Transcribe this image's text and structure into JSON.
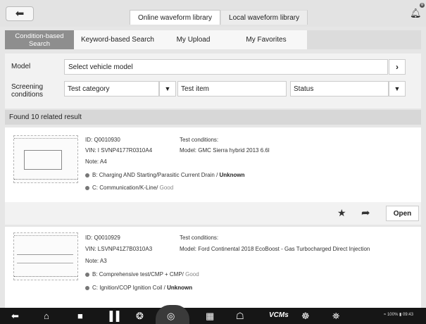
{
  "header": {
    "tabs": [
      {
        "label": "Online waveform library",
        "active": true
      },
      {
        "label": "Local waveform library",
        "active": false
      }
    ]
  },
  "subtabs": [
    {
      "label": "Condition-based Search",
      "active": true
    },
    {
      "label": "Keyword-based Search",
      "active": false
    },
    {
      "label": "My Upload",
      "active": false
    },
    {
      "label": "My Favorites",
      "active": false
    }
  ],
  "filters": {
    "model_label": "Model",
    "model_value": "Select vehicle model",
    "screening_label": "Screening conditions",
    "test_category": "Test category",
    "test_item": "Test item",
    "status": "Status"
  },
  "found_text": "Found 10 related result",
  "results": [
    {
      "id": "ID: Q0010930",
      "vin": "VIN: I SVNP4177R0310A4",
      "note": "Note: A4",
      "test_conditions_label": "Test conditions:",
      "model": "Model: GMC Sierra hybrid 2013 6.6l",
      "line_b_text": "B: Charging AND Starting/Parasitic Current Drain / ",
      "line_b_status": "Unknown",
      "line_c_text": "C: Communication/K-Line/ ",
      "line_c_status": "Good",
      "open_label": "Open"
    },
    {
      "id": "ID: Q0010929",
      "vin": "VIN: LSVNP41Z7B0310A3",
      "note": "Note: A3",
      "test_conditions_label": "Test conditions:",
      "model": "Model: Ford Continental 2018 EcoBoost - Gas Turbocharged Direct Injection",
      "line_b_text": "B: Comprehensive test/CMP + CMP/ ",
      "line_b_status": "Good",
      "line_c_text": "C: Ignition/COP Ignition Coil / ",
      "line_c_status": "Unknown"
    }
  ],
  "navbar": {
    "vcm_label": "VCMs",
    "status_text": "≈ 100% ▮ 09:43"
  },
  "colors": {
    "active_subtab": "#8e8e8e",
    "navbar": "#161616",
    "found_bar": "#d7d7d7"
  },
  "icons": [
    "back-arrow-icon",
    "bell-icon",
    "chevron-right-icon",
    "dropdown-arrow-icon",
    "star-icon",
    "share-icon",
    "home-icon",
    "camera-icon",
    "car-icon"
  ]
}
